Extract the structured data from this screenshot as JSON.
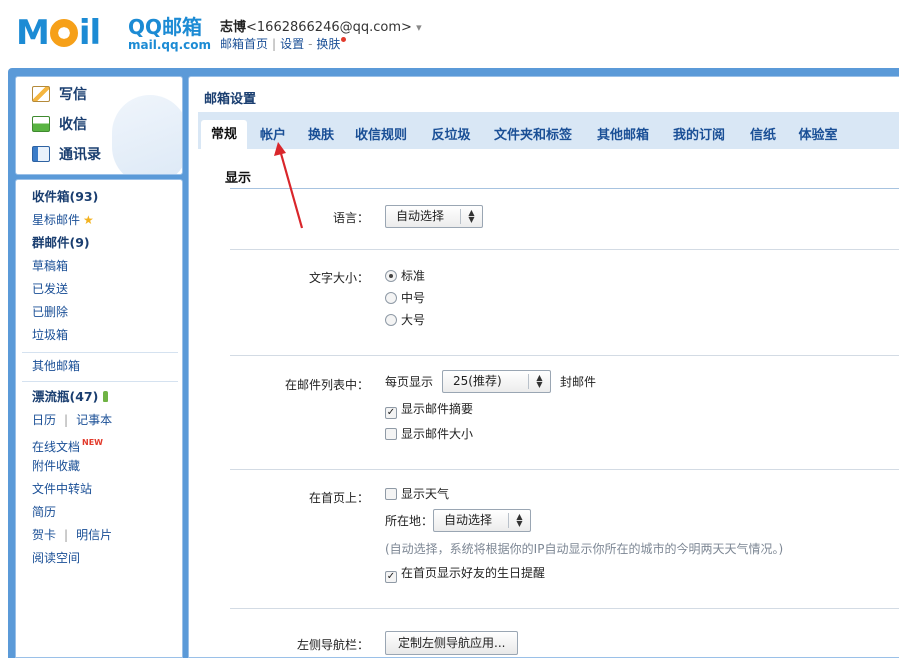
{
  "header": {
    "logo_main": "MOil",
    "logo_brand": "QQ邮箱",
    "logo_domain": "mail.qq.com",
    "user_name": "志博",
    "user_email": "<1662866246@qq.com>",
    "user_dropdown": "▾",
    "links": {
      "home": "邮箱首页",
      "settings": "设置",
      "skin": "换肤"
    },
    "sep": "|",
    "dash": "-"
  },
  "sidebar": {
    "compose": "写信",
    "receive": "收信",
    "contacts": "通讯录",
    "inbox": "收件箱(93)",
    "starred": "星标邮件",
    "group_mail": "群邮件(9)",
    "drafts": "草稿箱",
    "sent": "已发送",
    "deleted": "已删除",
    "spam": "垃圾箱",
    "other_mailbox": "其他邮箱",
    "drift_bottle": "漂流瓶(47)",
    "calendar": "日历",
    "notepad": "记事本",
    "online_docs": "在线文档",
    "new_badge": "NEW",
    "attachments": "附件收藏",
    "file_transfer": "文件中转站",
    "resume": "简历",
    "greeting_card": "贺卡",
    "postcard": "明信片",
    "reading_space": "阅读空间",
    "pipe": "|"
  },
  "settings": {
    "title": "邮箱设置",
    "tabs": [
      "常规",
      "帐户",
      "换肤",
      "收信规则",
      "反垃圾",
      "文件夹和标签",
      "其他邮箱",
      "我的订阅",
      "信纸",
      "体验室"
    ],
    "active_tab": "常规",
    "section_title": "显示",
    "language": {
      "label": "语言：",
      "value": "自动选择"
    },
    "font_size": {
      "label": "文字大小：",
      "options": [
        "标准",
        "中号",
        "大号"
      ],
      "selected": "标准"
    },
    "mail_list": {
      "label": "在邮件列表中：",
      "per_page_prefix": "每页显示",
      "per_page_value": "25(推荐)",
      "per_page_suffix": "封邮件",
      "show_summary": "显示邮件摘要",
      "show_summary_checked": true,
      "show_size": "显示邮件大小",
      "show_size_checked": false
    },
    "homepage": {
      "label": "在首页上：",
      "show_weather": "显示天气",
      "show_weather_checked": false,
      "location_label": "所在地：",
      "location_value": "自动选择",
      "hint": "(自动选择，系统将根据你的IP自动显示你所在的城市的今明两天天气情况。)",
      "birthday_reminder": "在首页显示好友的生日提醒",
      "birthday_checked": true
    },
    "left_nav": {
      "label": "左侧导航栏：",
      "button": "定制左侧导航应用..."
    }
  },
  "colors": {
    "frame_blue": "#5b9ad8",
    "tab_bar": "#d9e7f5",
    "link_blue": "#1a4f96",
    "annotation_red": "#d9262b"
  }
}
